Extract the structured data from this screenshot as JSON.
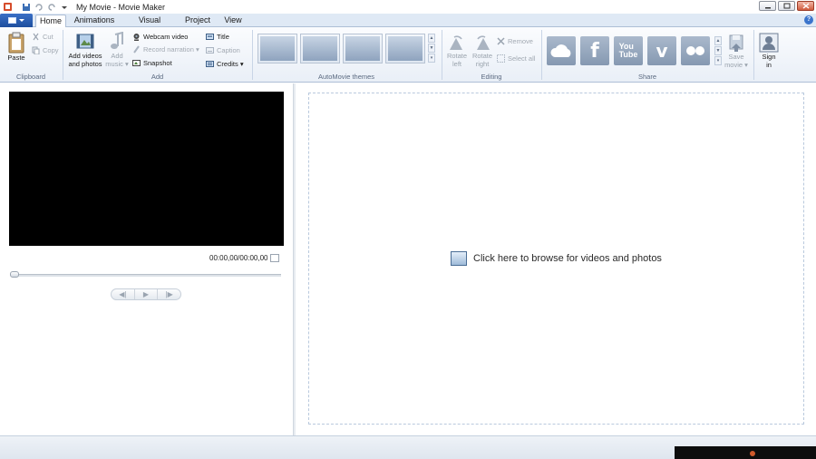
{
  "window": {
    "title": "My Movie - Movie Maker",
    "minimize": "minimize",
    "maximize": "maximize",
    "close": "close"
  },
  "tabs": [
    {
      "label": "Home",
      "active": true
    },
    {
      "label": "Animations"
    },
    {
      "label": "Visual Effects"
    },
    {
      "label": "Project"
    },
    {
      "label": "View"
    }
  ],
  "ribbon": {
    "clipboard": {
      "label": "Clipboard",
      "paste": "Paste",
      "cut": "Cut",
      "copy": "Copy"
    },
    "add": {
      "label": "Add",
      "add_videos_line1": "Add videos",
      "add_videos_line2": "and photos",
      "add_music_line1": "Add",
      "add_music_line2": "music ▾",
      "webcam": "Webcam video",
      "narration": "Record narration ▾",
      "snapshot": "Snapshot",
      "title": "Title",
      "caption": "Caption",
      "credits": "Credits ▾"
    },
    "themes": {
      "label": "AutoMovie themes"
    },
    "editing": {
      "label": "Editing",
      "rotate_left_1": "Rotate",
      "rotate_left_2": "left",
      "rotate_right_1": "Rotate",
      "rotate_right_2": "right",
      "remove": "Remove",
      "select_all": "Select all"
    },
    "share": {
      "label": "Share",
      "services": [
        "OneDrive",
        "Facebook",
        "YouTube",
        "Vimeo",
        "Flickr"
      ],
      "save_movie_1": "Save",
      "save_movie_2": "movie ▾",
      "sign_in_1": "Sign",
      "sign_in_2": "in"
    }
  },
  "preview": {
    "timecode": "00:00,00/00:00,00"
  },
  "storyboard": {
    "prompt": "Click here to browse for videos and photos"
  },
  "colors": {
    "accent": "#1e4f9e",
    "ribbon_bg": "#e9eff7",
    "preview_bg": "#000000"
  }
}
